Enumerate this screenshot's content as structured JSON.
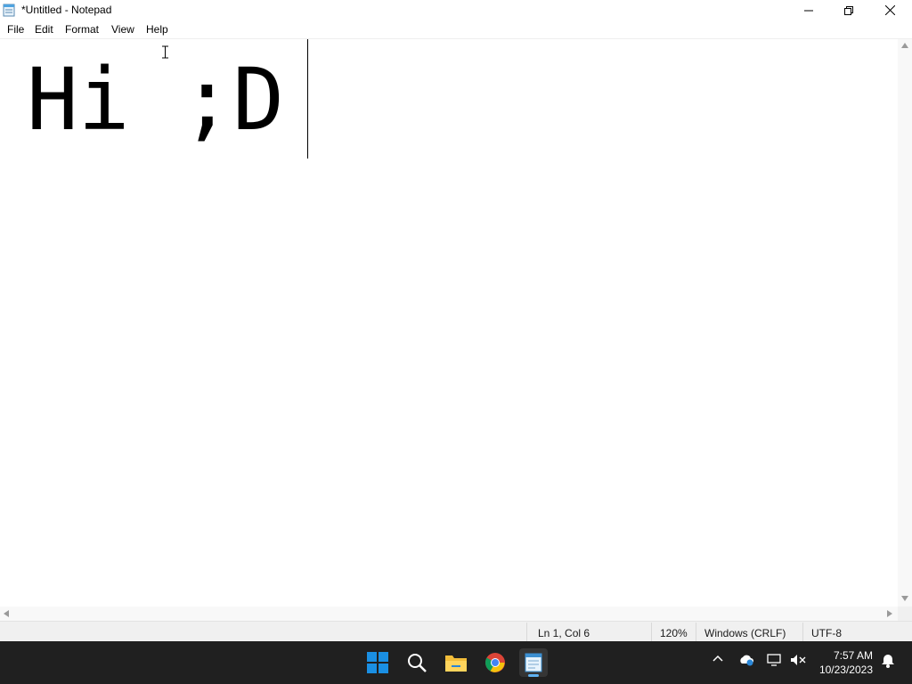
{
  "window": {
    "title": "*Untitled - Notepad"
  },
  "menu": {
    "file": "File",
    "edit": "Edit",
    "format": "Format",
    "view": "View",
    "help": "Help"
  },
  "editor": {
    "text": "Hi ;D"
  },
  "status": {
    "position": "Ln 1, Col 6",
    "zoom": "120%",
    "line_ending": "Windows (CRLF)",
    "encoding": "UTF-8"
  },
  "taskbar": {
    "time": "7:57 AM",
    "date": "10/23/2023"
  },
  "icons": [
    "notepad-icon",
    "minimize-icon",
    "restore-icon",
    "close-icon",
    "windows-start-icon",
    "search-icon",
    "file-explorer-icon",
    "chrome-icon",
    "notepad-taskbar-icon",
    "chevron-up-icon",
    "onedrive-icon",
    "network-icon",
    "volume-muted-icon",
    "notification-bell-icon"
  ],
  "colors": {
    "taskbar": "#202020",
    "accent_blue": "#0a7ad4",
    "editor_bg": "#ffffff"
  }
}
